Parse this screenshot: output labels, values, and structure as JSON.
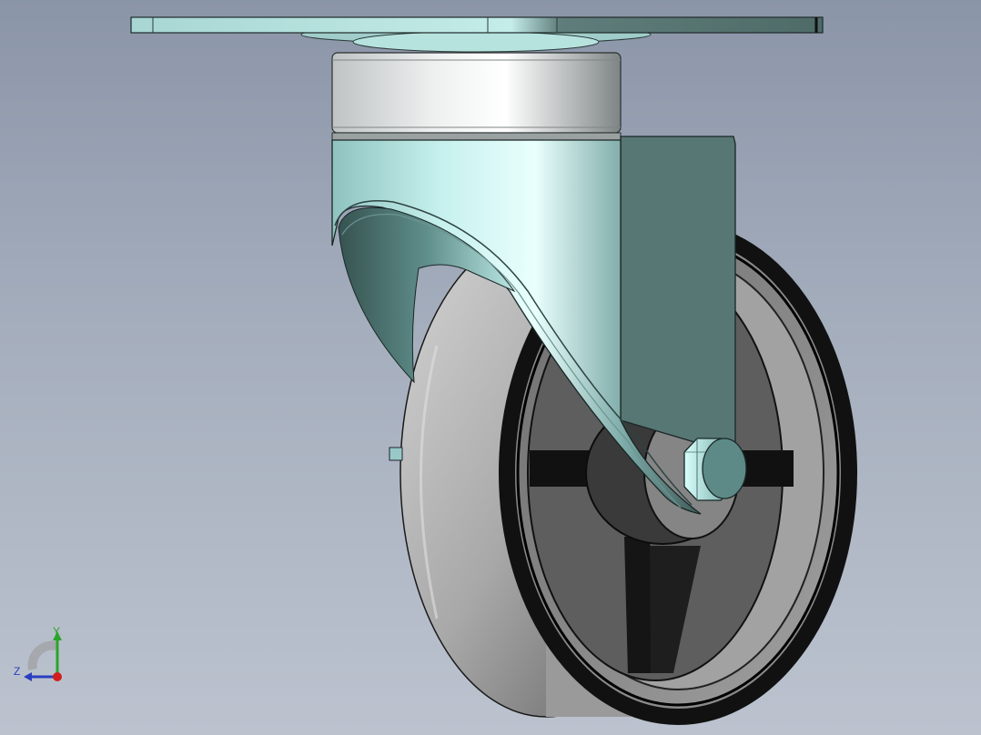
{
  "viewport": {
    "background_top": "#8b95a8",
    "background_bottom": "#bcc3cf"
  },
  "model": {
    "part_colors": {
      "mount_plate": "#a9dcd8",
      "swivel_bearing": "#d7dada",
      "fork": "#8fc9c6",
      "fork_side_shadow": "#5a7673",
      "wheel_tread": "#8c8c8c",
      "wheel_rim": "#1c1c1c",
      "axle_bolt": "#8fc9c6"
    },
    "icons": [
      "caster-wheel-model-icon"
    ]
  },
  "triad": {
    "y_label": "Y",
    "z_label": "Z",
    "y_color": "#2aa52a",
    "z_color": "#2a3fbf",
    "x_color": "#d21e1e"
  }
}
